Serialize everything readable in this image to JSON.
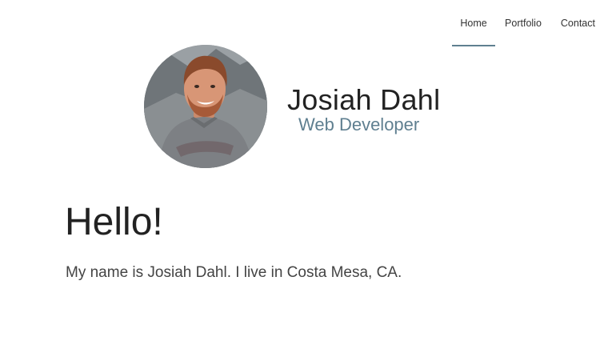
{
  "nav": {
    "items": [
      {
        "label": "Home",
        "active": true
      },
      {
        "label": "Portfolio",
        "active": false
      },
      {
        "label": "Contact",
        "active": false
      }
    ]
  },
  "header": {
    "name": "Josiah Dahl",
    "role": "Web Developer"
  },
  "main": {
    "heading": "Hello!",
    "intro": "My name is Josiah Dahl. I live in Costa Mesa, CA."
  },
  "colors": {
    "accent": "#5f7f90",
    "text": "#222222"
  }
}
